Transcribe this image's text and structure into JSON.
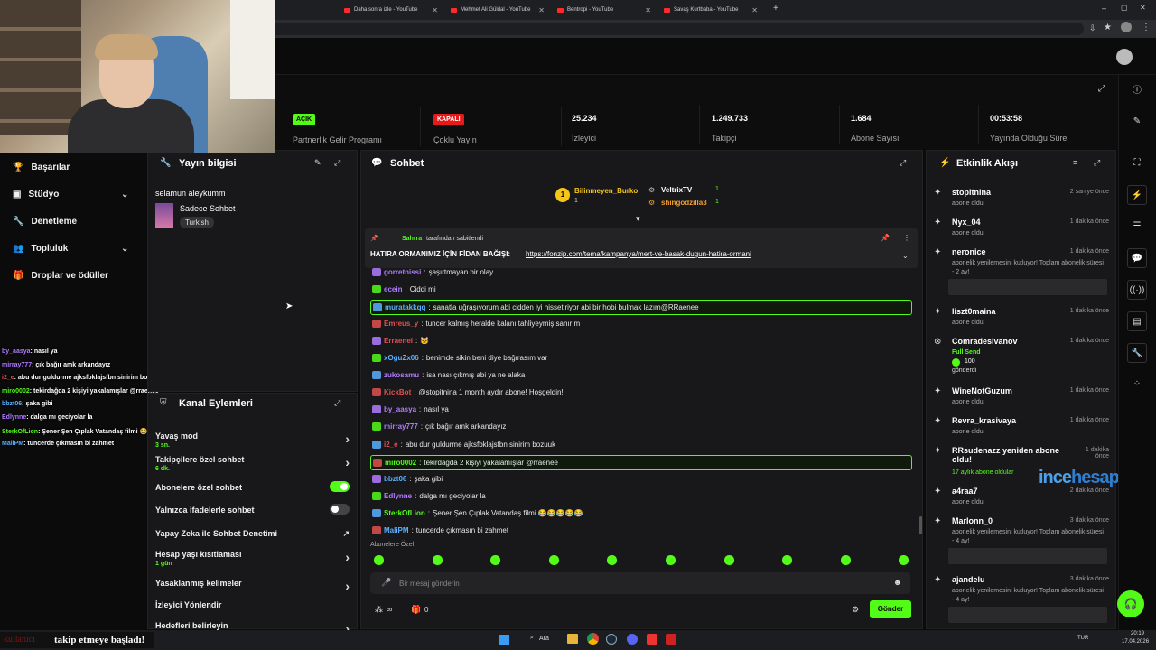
{
  "browser": {
    "tabs": [
      "Daha sonra izle - YouTube",
      "Mehmet Ali Güldal - YouTube",
      "Bentropi - YouTube",
      "Savaş Kurtbaba - YouTube"
    ]
  },
  "stats": {
    "partner": {
      "badge": "AÇIK",
      "label": "Partnerlik Gelir Programı",
      "color": "#53fc18"
    },
    "multi": {
      "badge": "KAPALI",
      "label": "Çoklu Yayın",
      "color": "#e51b1b"
    },
    "viewers": {
      "value": "25.234",
      "label": "İzleyici"
    },
    "followers": {
      "value": "1.249.733",
      "label": "Takipçi"
    },
    "subs": {
      "value": "1.684",
      "label": "Abone Sayısı"
    },
    "uptime": {
      "value": "00:53:58",
      "label": "Yayında Olduğu Süre"
    }
  },
  "nav": {
    "items": [
      {
        "label": "Başarılar",
        "icon": "trophy-icon"
      },
      {
        "label": "Stüdyo",
        "icon": "studio-icon"
      },
      {
        "label": "Denetleme",
        "icon": "wrench-icon"
      },
      {
        "label": "Topluluk",
        "icon": "community-icon"
      },
      {
        "label": "Droplar ve ödüller",
        "icon": "gift-icon"
      }
    ]
  },
  "overlay_chat": [
    {
      "user": "by_aasya",
      "msg": "nasıl ya",
      "color": "#b07cff"
    },
    {
      "user": "mirray777",
      "msg": "çık bağır amk arkandayız",
      "color": "#b07cff"
    },
    {
      "user": "i2_e",
      "msg": "abu dur guldurme ajksfbklajsfbn sinirim bozuuk",
      "color": "#e05050"
    },
    {
      "user": "miro0002",
      "msg": "tekirdağda 2 kişiyi yakalamışlar @rraenee",
      "color": "#53fc18"
    },
    {
      "user": "bbzt06",
      "msg": "şaka gibi",
      "color": "#5ab0ff"
    },
    {
      "user": "Edlynne",
      "msg": "dalga mı geciyolar la",
      "color": "#b07cff"
    },
    {
      "user": "SterkOfLion",
      "msg": "Şener Şen Çıplak Vatandaş filmi 😂😂😂😂😂",
      "color": "#53fc18"
    },
    {
      "user": "MaliPM",
      "msg": "tuncerde çıkmasın bi zahmet",
      "color": "#5ab0ff"
    }
  ],
  "follow_alert": {
    "user": "kullanıcı",
    "text": "takip etmeye başladı!"
  },
  "stream_info": {
    "title": "Yayın bilgisi",
    "stream_title": "selamun aleykumm",
    "category": "Sadece Sohbet",
    "tag": "Turkish"
  },
  "channel_actions": {
    "title": "Kanal Eylemleri",
    "items": [
      {
        "label": "Yavaş mod",
        "sub": "3 sn.",
        "type": "arrow"
      },
      {
        "label": "Takipçilere özel sohbet",
        "sub": "6 dk.",
        "type": "arrow"
      },
      {
        "label": "Abonelere özel sohbet",
        "sub": "",
        "type": "toggle-on"
      },
      {
        "label": "Yalnızca ifadelerle sohbet",
        "sub": "",
        "type": "toggle-off"
      },
      {
        "label": "Yapay Zeka ile Sohbet Denetimi",
        "sub": "",
        "type": "external"
      },
      {
        "label": "Hesap yaşı kısıtlaması",
        "sub": "1 gün",
        "type": "arrow"
      },
      {
        "label": "Yasaklanmış kelimeler",
        "sub": "",
        "type": "arrow"
      },
      {
        "label": "İzleyici Yönlendir",
        "sub": "",
        "type": "none"
      },
      {
        "label": "Hedefleri belirleyin",
        "sub": "Aktif hedefler",
        "type": "arrow"
      }
    ]
  },
  "chat": {
    "title": "Sohbet",
    "leaderboard": [
      {
        "rank": "1",
        "user": "Bilinmeyen_Burko",
        "count": "1"
      },
      {
        "user": "VeltrixTV",
        "count": "1"
      },
      {
        "user": "shingodzilla3",
        "count": "1"
      }
    ],
    "pinned": {
      "by_user": "Sahrra",
      "by_text": "tarafından sabitlendi",
      "text": "HATIRA ORMANIMIZ İÇİN FİDAN BAĞIŞI:",
      "link": "https://fonzip.com/tema/kampanya/mert-ve-basak-dugun-hatira-ormani"
    },
    "messages": [
      {
        "user": "gorretnissi",
        "msg": "şaşırtmayan bir olay",
        "color": "#b07cff",
        "hl": false
      },
      {
        "user": "ecein",
        "msg": "Ciddi mi",
        "color": "#b07cff",
        "hl": false
      },
      {
        "user": "muratakkqq",
        "msg": "sanatla uğraşıyorum abi cidden iyi hissetiriyor abi bir hobi bulmak lazım@RRaenee",
        "color": "#5ab0ff",
        "hl": true
      },
      {
        "user": "Emreus_y",
        "msg": "tuncer kalmış heralde kalanı tahliyeymiş sanırım",
        "color": "#e05050",
        "hl": false
      },
      {
        "user": "Erraenei",
        "msg": "🐱",
        "color": "#e05050",
        "hl": false
      },
      {
        "user": "xOguZx06",
        "msg": "benimde sikin beni diye bağırasım var",
        "color": "#5ab0ff",
        "hl": false
      },
      {
        "user": "zukosamu",
        "msg": "isa nası çıkmış abi ya ne alaka",
        "color": "#b07cff",
        "hl": false
      },
      {
        "user": "KickBot",
        "msg": "@stopitnina 1 month aydır abone! Hoşgeldin!",
        "color": "#e05050",
        "hl": false
      },
      {
        "user": "by_aasya",
        "msg": "nasıl ya",
        "color": "#b07cff",
        "hl": false
      },
      {
        "user": "mirray777",
        "msg": "çık bağır amk arkandayız",
        "color": "#b07cff",
        "hl": false
      },
      {
        "user": "i2_e",
        "msg": "abu dur guldurme ajksfbklajsfbn sinirim bozuuk",
        "color": "#e05050",
        "hl": false
      },
      {
        "user": "miro0002",
        "msg": "tekirdağda 2 kişiyi yakalamışlar @rraenee",
        "color": "#53fc18",
        "hl": true
      },
      {
        "user": "bbzt06",
        "msg": "şaka gibi",
        "color": "#5ab0ff",
        "hl": false
      },
      {
        "user": "Edlynne",
        "msg": "dalga mı geciyolar la",
        "color": "#b07cff",
        "hl": false
      },
      {
        "user": "SterkOfLion",
        "msg": "Şener Şen Çıplak Vatandaş filmi 😂😂😂😂😂",
        "color": "#53fc18",
        "hl": false
      },
      {
        "user": "MaliPM",
        "msg": "tuncerde çıkmasın bi zahmet",
        "color": "#5ab0ff",
        "hl": false
      }
    ],
    "emote_label": "Abonelere Özel",
    "input_placeholder": "Bir mesaj gönderin",
    "points": "∞",
    "gifts": "0",
    "send_label": "Gönder"
  },
  "activity": {
    "title": "Etkinlik Akışı",
    "items": [
      {
        "name": "stopitnina",
        "sub": "abone oldu",
        "time": "2 saniye önce",
        "icon": "sparkle-icon"
      },
      {
        "name": "Nyx_04",
        "sub": "abone oldu",
        "time": "1 dakika önce",
        "icon": "sparkle-icon"
      },
      {
        "name": "neronice",
        "sub": "abonelik yenilemesini kutluyor! Toplam abonelik süresi - 2 ay!",
        "time": "1 dakika önce",
        "icon": "sparkle-icon"
      },
      {
        "name": "liszt0maina",
        "sub": "abone oldu",
        "time": "1 dakika önce",
        "icon": "sparkle-icon"
      },
      {
        "name": "Comradeslvanov",
        "sub": "Full Send",
        "sub2": "100",
        "sub3": "gönderdi",
        "time": "1 dakika önce",
        "icon": "kick-icon"
      },
      {
        "name": "WineNotGuzum",
        "sub": "abone oldu",
        "time": "1 dakika önce",
        "icon": "sparkle-icon"
      },
      {
        "name": "Revra_krasivaya",
        "sub": "abone oldu",
        "time": "1 dakika önce",
        "icon": "sparkle-icon"
      },
      {
        "name": "RRsudenazz yeniden abone oldu!",
        "sub": "17 aylık abone oldular",
        "time": "1 dakika önce",
        "icon": "sparkle-icon"
      },
      {
        "name": "a4raa7",
        "sub": "abone oldu",
        "time": "2 dakika önce",
        "icon": "sparkle-icon"
      },
      {
        "name": "Marlonn_0",
        "sub": "abonelik yenilemesini kutluyor! Toplam abonelik süresi - 4 ay!",
        "time": "3 dakika önce",
        "icon": "sparkle-icon"
      },
      {
        "name": "ajandelu",
        "sub": "abonelik yenilemesini kutluyor! Toplam abonelik süresi - 4 ay!",
        "time": "3 dakika önce",
        "icon": "sparkle-icon"
      }
    ]
  },
  "watermark": {
    "part1": "ince",
    "part2": "hesap",
    ".com": ".com"
  },
  "taskbar": {
    "search": "Ara",
    "lang": "TUR",
    "time": "20:19",
    "date": "17.04.2026"
  },
  "colors": {
    "accent": "#53fc18",
    "panel": "#18181a",
    "bg": "#0b0b0c"
  }
}
